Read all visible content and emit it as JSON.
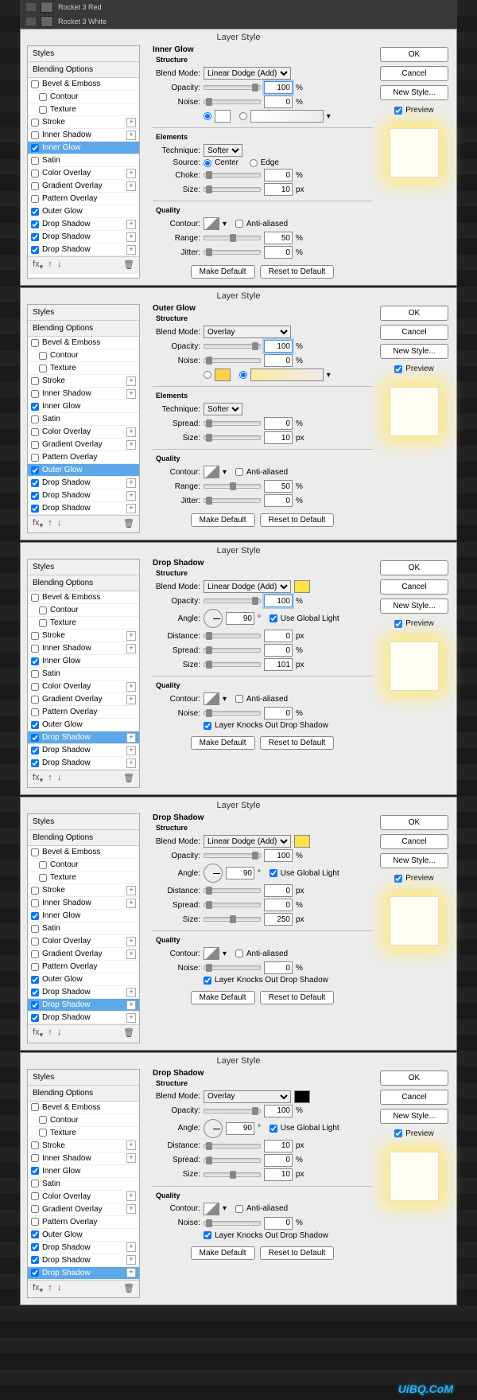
{
  "title": "Layer Style",
  "layers": [
    {
      "name": "Rocket 3 Red"
    },
    {
      "name": "Rocket 3 White"
    }
  ],
  "left": {
    "styles": "Styles",
    "blending": "Blending Options",
    "items": [
      {
        "k": "bevel",
        "l": "Bevel & Emboss",
        "c": false
      },
      {
        "k": "contourSub",
        "l": "Contour",
        "c": false,
        "sub": true
      },
      {
        "k": "textureSub",
        "l": "Texture",
        "c": false,
        "sub": true
      },
      {
        "k": "stroke",
        "l": "Stroke",
        "c": false,
        "p": true
      },
      {
        "k": "ishadow",
        "l": "Inner Shadow",
        "c": false,
        "p": true
      },
      {
        "k": "iglow",
        "l": "Inner Glow",
        "c": true
      },
      {
        "k": "satin",
        "l": "Satin",
        "c": false
      },
      {
        "k": "coverlay",
        "l": "Color Overlay",
        "c": false,
        "p": true
      },
      {
        "k": "goverlay",
        "l": "Gradient Overlay",
        "c": false,
        "p": true
      },
      {
        "k": "poverlay",
        "l": "Pattern Overlay",
        "c": false
      },
      {
        "k": "oglow",
        "l": "Outer Glow",
        "c": true
      },
      {
        "k": "dshadow1",
        "l": "Drop Shadow",
        "c": true,
        "p": true
      },
      {
        "k": "dshadow2",
        "l": "Drop Shadow",
        "c": true,
        "p": true
      },
      {
        "k": "dshadow3",
        "l": "Drop Shadow",
        "c": true,
        "p": true
      }
    ],
    "fx": "fx"
  },
  "selections": [
    "iglow",
    "oglow",
    "dshadow1",
    "dshadow2",
    "dshadow3"
  ],
  "rbtn": {
    "ok": "OK",
    "cancel": "Cancel",
    "newstyle": "New Style...",
    "preview": "Preview"
  },
  "common": {
    "structure": "Structure",
    "elements": "Elements",
    "quality": "Quality",
    "blendmode": "Blend Mode:",
    "opacity": "Opacity:",
    "noise": "Noise:",
    "technique": "Technique:",
    "source": "Source:",
    "center": "Center",
    "edge": "Edge",
    "choke": "Choke:",
    "spread": "Spread:",
    "size": "Size:",
    "contour": "Contour:",
    "anti": "Anti-aliased",
    "range": "Range:",
    "jitter": "Jitter:",
    "angle": "Angle:",
    "ugl": "Use Global Light",
    "distance": "Distance:",
    "knock": "Layer Knocks Out Drop Shadow",
    "makedef": "Make Default",
    "resetdef": "Reset to Default",
    "pct": "%",
    "px": "px",
    "deg": "°"
  },
  "panels": [
    {
      "head": "Inner Glow",
      "sel": "iglow",
      "mode": "Linear Dodge (Add)",
      "opacity": "100",
      "noise": "0",
      "color1": "#ffffff",
      "hasTech": true,
      "tech": "Softer",
      "hasSource": true,
      "choke": "0",
      "size": "10",
      "range": "50",
      "jitter": "0"
    },
    {
      "head": "Outer Glow",
      "sel": "oglow",
      "mode": "Overlay",
      "opacity": "100",
      "noise": "0",
      "color1": "#ffd24a",
      "grad": "#fbe9a0",
      "hasTech": true,
      "tech": "Softer",
      "spread": "0",
      "size": "10",
      "range": "50",
      "jitter": "0"
    },
    {
      "head": "Drop Shadow",
      "sel": "dshadow1",
      "mode": "Linear Dodge (Add)",
      "modeColor": "#ffe14a",
      "opacity": "100",
      "angle": "90",
      "ugl": true,
      "distance": "0",
      "spread": "0",
      "size": "101",
      "noise2": "0",
      "knock": true
    },
    {
      "head": "Drop Shadow",
      "sel": "dshadow2",
      "mode": "Linear Dodge (Add)",
      "modeColor": "#ffe14a",
      "opacity": "100",
      "angle": "90",
      "ugl": true,
      "distance": "0",
      "spread": "0",
      "size": "250",
      "noise2": "0",
      "knock": true
    },
    {
      "head": "Drop Shadow",
      "sel": "dshadow3",
      "mode": "Overlay",
      "modeColor": "#000000",
      "opacity": "100",
      "angle": "90",
      "ugl": true,
      "distance": "10",
      "spread": "0",
      "size": "10",
      "noise2": "0",
      "knock": true
    }
  ],
  "watermark": "UiBQ.CoM"
}
